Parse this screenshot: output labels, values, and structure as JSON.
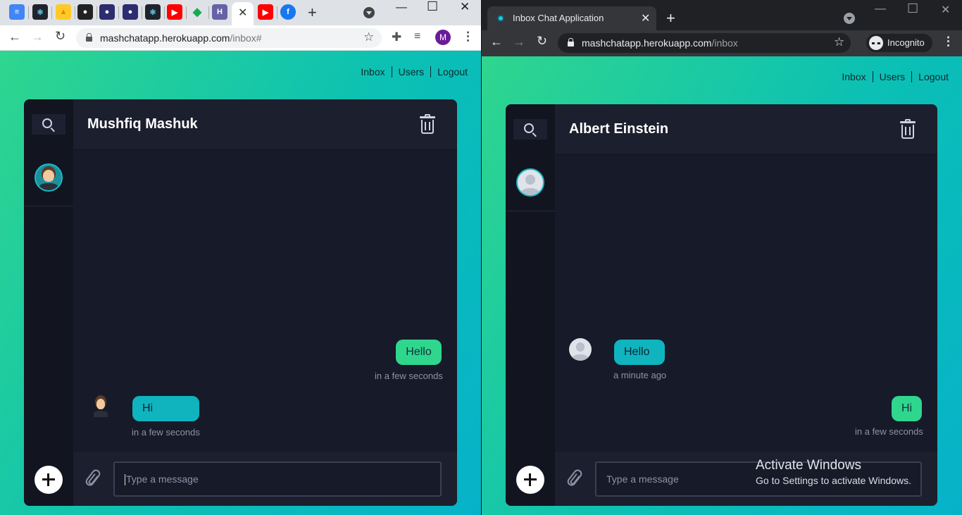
{
  "left_window": {
    "address_url": "mashchatapp.herokuapp.com",
    "address_path": "/inbox#",
    "profile_initial": "M",
    "nav": {
      "inbox": "Inbox",
      "users": "Users",
      "logout": "Logout"
    },
    "chat": {
      "header_name": "Mushfiq Mashuk",
      "messages": [
        {
          "direction": "outgoing",
          "text": "Hello",
          "time": "in a few seconds"
        },
        {
          "direction": "incoming",
          "text": "Hi",
          "time": "in a few seconds"
        }
      ],
      "input_placeholder": "Type a message"
    }
  },
  "right_window": {
    "tab_title": "Inbox Chat Application",
    "address_url": "mashchatapp.herokuapp.com",
    "address_path": "/inbox",
    "incognito_label": "Incognito",
    "nav": {
      "inbox": "Inbox",
      "users": "Users",
      "logout": "Logout"
    },
    "chat": {
      "header_name": "Albert Einstein",
      "messages": [
        {
          "direction": "incoming",
          "text": "Hello",
          "time": "a minute ago"
        },
        {
          "direction": "outgoing",
          "text": "Hi",
          "time": "in a few seconds"
        }
      ],
      "input_placeholder": "Type a message"
    }
  },
  "watermark": {
    "title": "Activate Windows",
    "subtitle": "Go to Settings to activate Windows."
  },
  "colors": {
    "outgoing_bubble": "#2fd68e",
    "incoming_bubble": "#0fb4bf",
    "chat_bg": "#171a28",
    "gradient_start": "#2fd68e",
    "gradient_end": "#06b2c9"
  },
  "icons": [
    "docs-icon",
    "react-icon",
    "firebase-icon",
    "github-icon",
    "youtube-icon",
    "mongodb-icon",
    "heroku-icon",
    "facebook-icon",
    "search-icon",
    "trash-icon",
    "plus-icon",
    "paperclip-icon",
    "incognito-icon"
  ]
}
